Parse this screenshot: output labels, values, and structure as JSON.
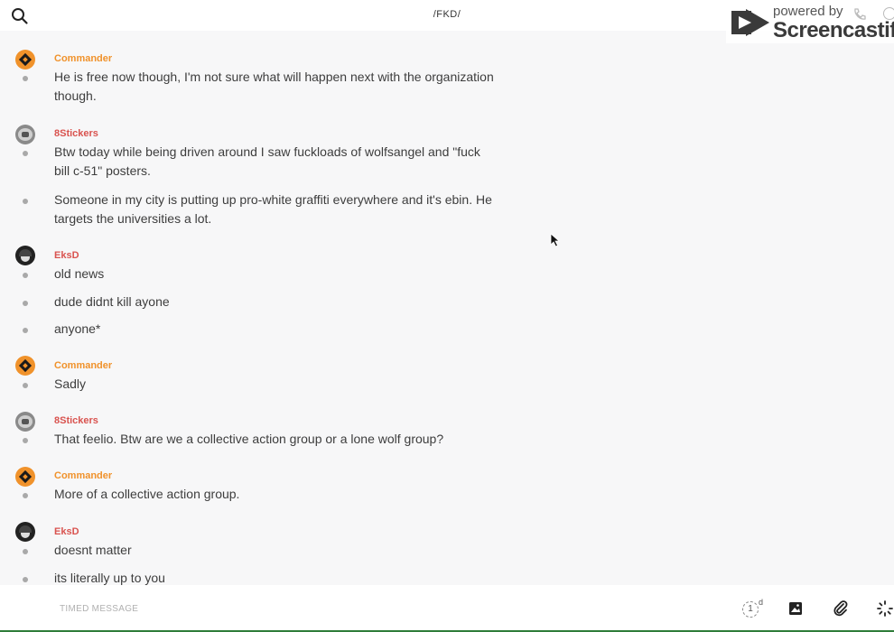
{
  "header": {
    "title": "/FKD/"
  },
  "watermark": {
    "powered": "powered by",
    "brand": "Screencastify"
  },
  "colors": {
    "commander": "#f0922b",
    "stickers": "#d9534f",
    "eksd": "#d9534f",
    "accent": "#2f7d3a"
  },
  "icons": {
    "search": "search-icon",
    "image": "image-icon",
    "attach": "paperclip-icon",
    "more": "loading-icon",
    "timer": "timer-icon"
  },
  "messages": [
    {
      "author": "Commander",
      "texts": [
        "He is free now though, I'm not sure what will happen next with the organization though."
      ]
    },
    {
      "author": "8Stickers",
      "texts": [
        "Btw today while being driven around I saw fuckloads of wolfsangel and \"fuck bill c-51\" posters.",
        "Someone in my city is putting up pro-white graffiti everywhere and it's ebin. He targets the universities a lot."
      ]
    },
    {
      "author": "EksD",
      "texts": [
        "old news",
        "dude didnt kill ayone",
        "anyone*"
      ]
    },
    {
      "author": "Commander",
      "texts": [
        "Sadly"
      ]
    },
    {
      "author": "8Stickers",
      "texts": [
        "That feelio. Btw are we a collective action group or a lone wolf group?"
      ]
    },
    {
      "author": "Commander",
      "texts": [
        "More of a collective action group."
      ]
    },
    {
      "author": "EksD",
      "texts": [
        "doesnt matter",
        "its literally up to you"
      ]
    }
  ],
  "composer": {
    "placeholder": "TIMED MESSAGE",
    "timer_value": "1",
    "timer_unit": "d"
  }
}
